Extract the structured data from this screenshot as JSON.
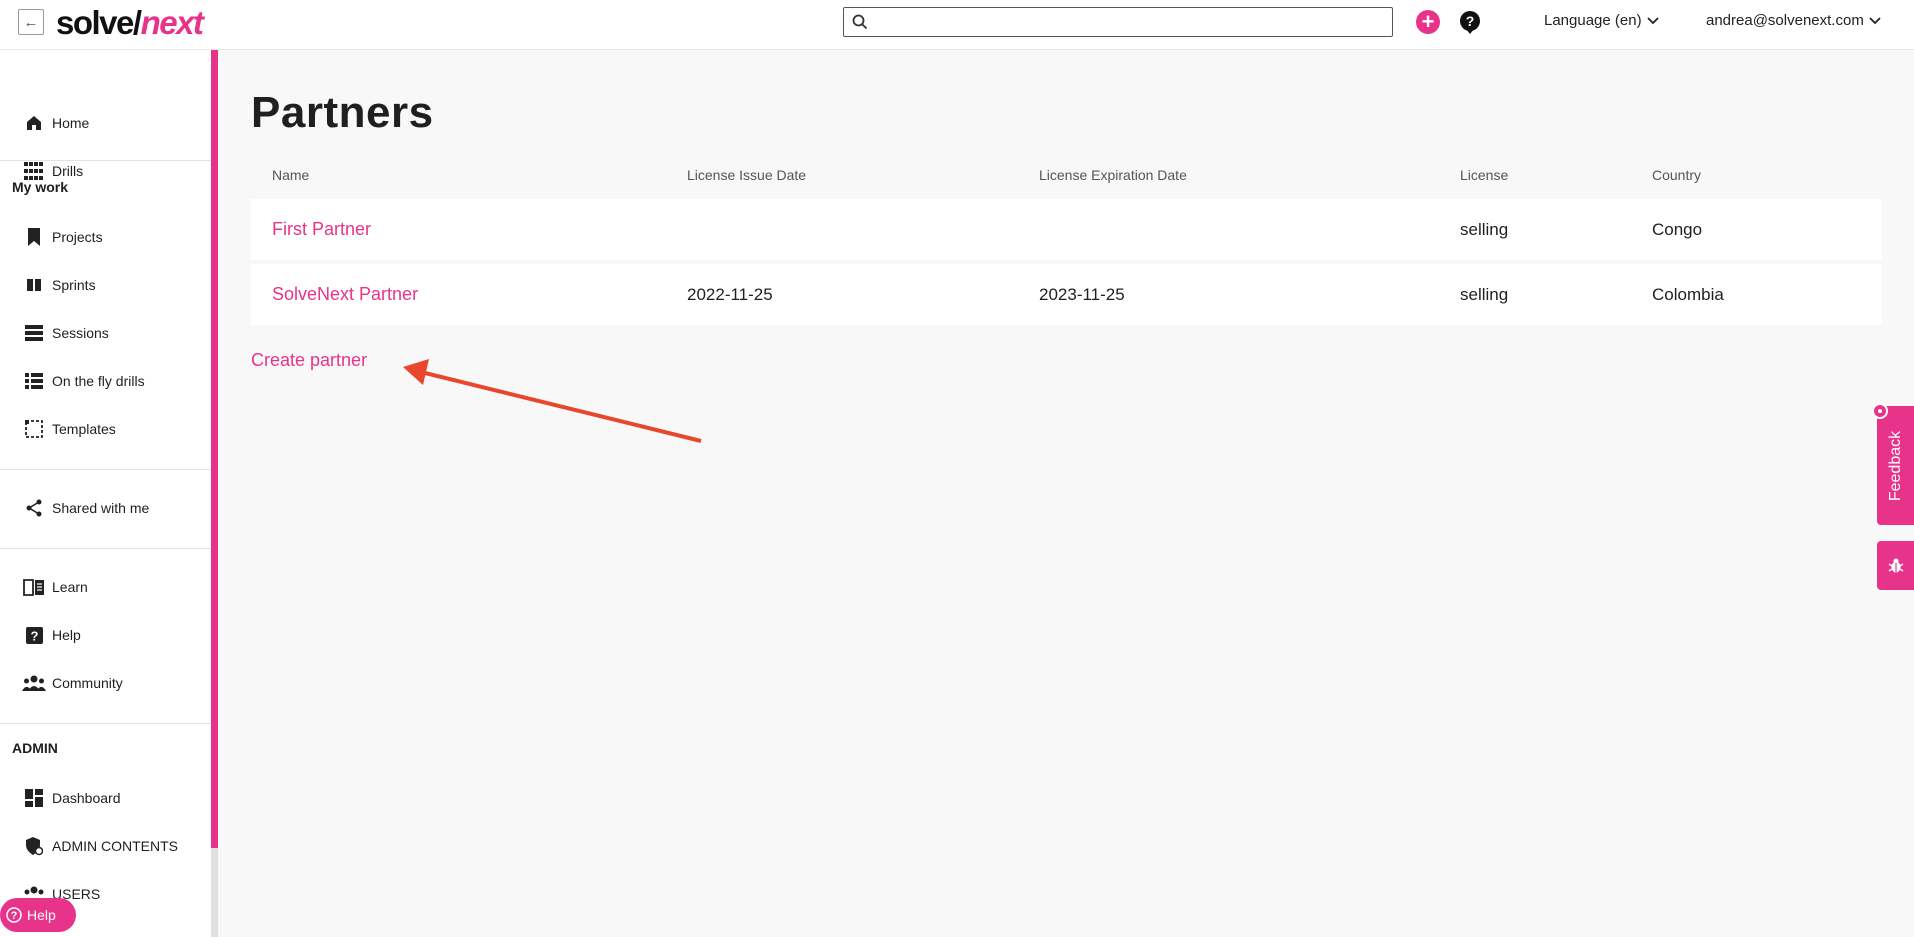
{
  "app": {
    "logo_part1": "solve/",
    "logo_part2": "next"
  },
  "topbar": {
    "search_placeholder": "",
    "language_label": "Language (en)",
    "user_email": "andrea@solvenext.com"
  },
  "sidebar": {
    "top_items": [
      {
        "label": "Home",
        "icon": "home-icon"
      },
      {
        "label": "Drills",
        "icon": "grid-icon"
      }
    ],
    "my_work_title": "My work",
    "my_work_items": [
      {
        "label": "Projects",
        "icon": "bookmark-icon"
      },
      {
        "label": "Sprints",
        "icon": "columns-icon"
      },
      {
        "label": "Sessions",
        "icon": "list-icon"
      },
      {
        "label": "On the fly drills",
        "icon": "checklist-icon"
      },
      {
        "label": "Templates",
        "icon": "template-icon"
      }
    ],
    "shared_item": {
      "label": "Shared with me",
      "icon": "share-icon"
    },
    "learn_items": [
      {
        "label": "Learn",
        "icon": "book-icon"
      },
      {
        "label": "Help",
        "icon": "help-icon"
      },
      {
        "label": "Community",
        "icon": "people-icon"
      }
    ],
    "admin_title": "ADMIN",
    "admin_items": [
      {
        "label": "Dashboard",
        "icon": "dashboard-icon"
      },
      {
        "label": "ADMIN CONTENTS",
        "icon": "shield-icon"
      },
      {
        "label": "USERS",
        "icon": "users-icon"
      }
    ],
    "help_pill_label": "Help"
  },
  "main": {
    "title": "Partners",
    "columns": [
      "Name",
      "License Issue Date",
      "License Expiration Date",
      "License",
      "Country"
    ],
    "rows": [
      {
        "name": "First Partner",
        "issue_date": "",
        "expiration_date": "",
        "license": "selling",
        "country": "Congo"
      },
      {
        "name": "SolveNext Partner",
        "issue_date": "2022-11-25",
        "expiration_date": "2023-11-25",
        "license": "selling",
        "country": "Colombia"
      }
    ],
    "create_label": "Create partner"
  },
  "side_tabs": {
    "feedback_label": "Feedback"
  },
  "colors": {
    "accent": "#e8338b",
    "annotation_arrow": "#e8472e"
  }
}
